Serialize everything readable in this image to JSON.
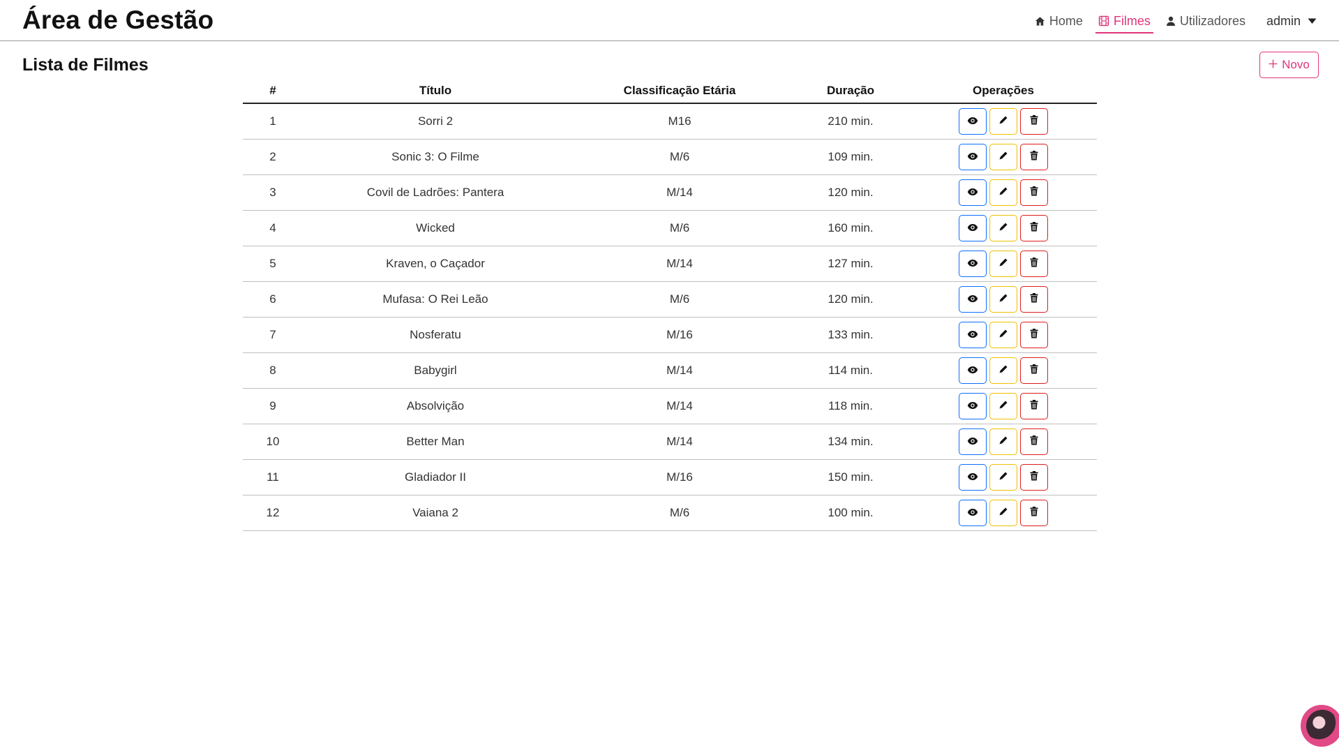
{
  "header": {
    "title": "Área de Gestão",
    "nav": [
      {
        "label": "Home",
        "icon": "home-icon",
        "active": false
      },
      {
        "label": "Filmes",
        "icon": "film-icon",
        "active": true
      },
      {
        "label": "Utilizadores",
        "icon": "user-icon",
        "active": false
      }
    ],
    "user": {
      "label": "admin",
      "icon": "caret-down-icon"
    }
  },
  "page": {
    "title": "Lista de Filmes",
    "new_button": {
      "label": "Novo",
      "icon": "plus-icon"
    }
  },
  "colors": {
    "accent": "#e0347a",
    "view": "#0d6efd",
    "edit": "#f0c000",
    "delete": "#dc1c1c"
  },
  "table": {
    "headers": [
      "#",
      "Título",
      "Classificação Etária",
      "Duração",
      "Operações"
    ],
    "rows": [
      {
        "num": "1",
        "title": "Sorri 2",
        "rating": "M16",
        "duration": "210 min."
      },
      {
        "num": "2",
        "title": "Sonic 3: O Filme",
        "rating": "M/6",
        "duration": "109 min."
      },
      {
        "num": "3",
        "title": "Covil de Ladrões: Pantera",
        "rating": "M/14",
        "duration": "120 min."
      },
      {
        "num": "4",
        "title": "Wicked",
        "rating": "M/6",
        "duration": "160 min."
      },
      {
        "num": "5",
        "title": "Kraven, o Caçador",
        "rating": "M/14",
        "duration": "127 min."
      },
      {
        "num": "6",
        "title": "Mufasa: O Rei Leão",
        "rating": "M/6",
        "duration": "120 min."
      },
      {
        "num": "7",
        "title": "Nosferatu",
        "rating": "M/16",
        "duration": "133 min."
      },
      {
        "num": "8",
        "title": "Babygirl",
        "rating": "M/14",
        "duration": "114 min."
      },
      {
        "num": "9",
        "title": "Absolvição",
        "rating": "M/14",
        "duration": "118 min."
      },
      {
        "num": "10",
        "title": "Better Man",
        "rating": "M/14",
        "duration": "134 min."
      },
      {
        "num": "11",
        "title": "Gladiador II",
        "rating": "M/16",
        "duration": "150 min."
      },
      {
        "num": "12",
        "title": "Vaiana 2",
        "rating": "M/6",
        "duration": "100 min."
      }
    ],
    "operations": [
      {
        "name": "view",
        "icon": "eye-icon"
      },
      {
        "name": "edit",
        "icon": "pencil-icon"
      },
      {
        "name": "delete",
        "icon": "trash-icon"
      }
    ]
  }
}
